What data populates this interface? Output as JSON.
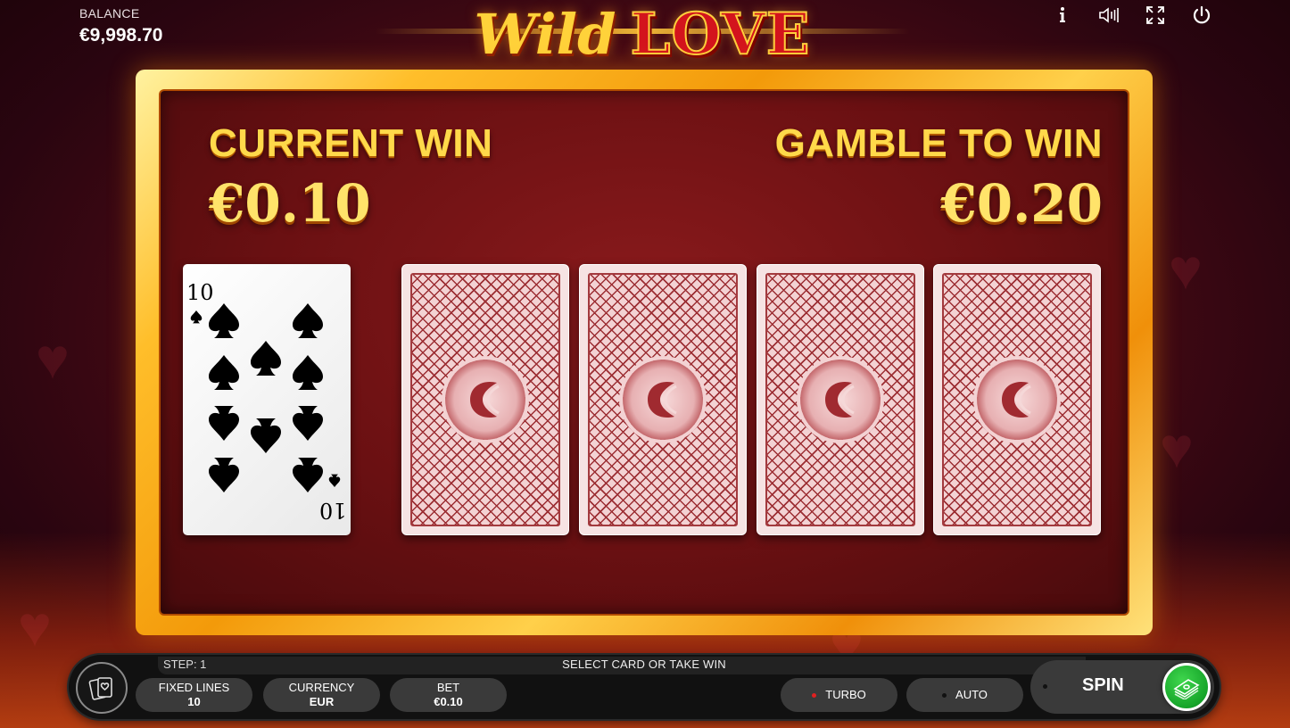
{
  "header": {
    "balance_label": "BALANCE",
    "balance_value": "€9,998.70",
    "logo_part1": "Wild",
    "logo_part2": "LOVE",
    "icons": [
      "info-icon",
      "sound-icon",
      "fullscreen-icon",
      "power-icon"
    ]
  },
  "gamble": {
    "current_win_label": "CURRENT WIN",
    "current_win_value": "€0.10",
    "gamble_to_win_label": "GAMBLE TO WIN",
    "gamble_to_win_value": "€0.20",
    "dealer_card": {
      "rank": "10",
      "suit": "spades"
    },
    "face_down_cards": 4
  },
  "bottom_bar": {
    "step_label": "STEP: 1",
    "status_text": "SELECT CARD OR TAKE WIN",
    "fixed_lines_label": "FIXED LINES",
    "fixed_lines_value": "10",
    "currency_label": "CURRENCY",
    "currency_value": "EUR",
    "bet_label": "BET",
    "bet_value": "€0.10",
    "turbo_label": "TURBO",
    "auto_label": "AUTO",
    "spin_label": "SPIN"
  },
  "colors": {
    "gold": "#ffd94a",
    "frame": "#f39a0a",
    "turbo_indicator": "#e02020",
    "collect_button": "#16a52a"
  }
}
